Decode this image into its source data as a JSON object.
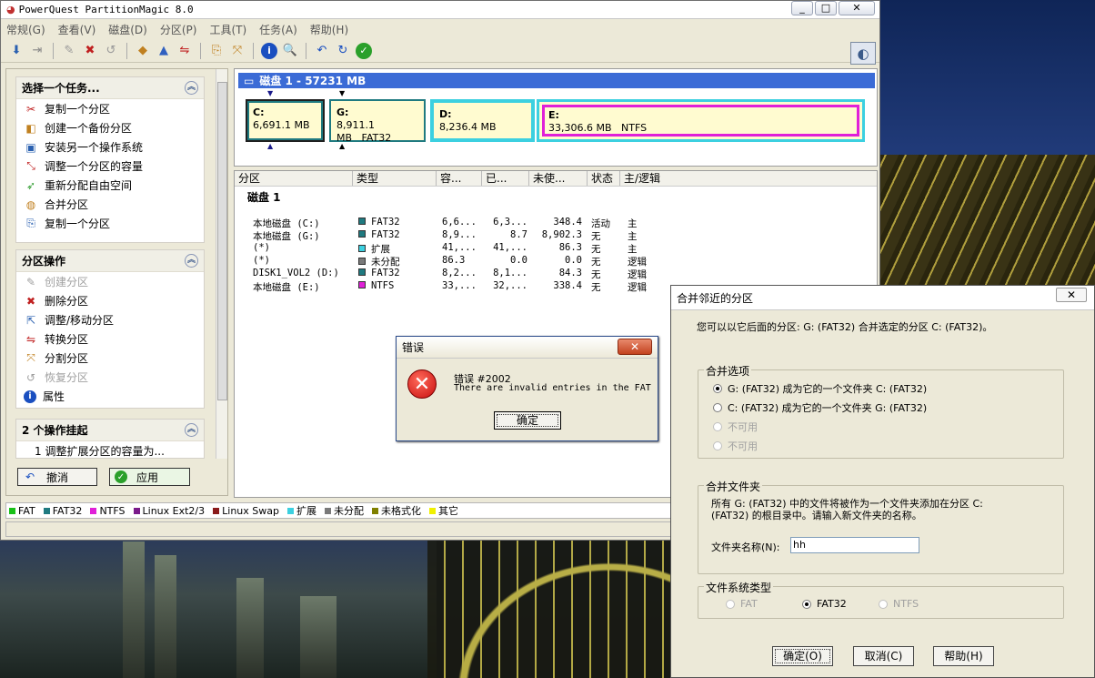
{
  "main_window": {
    "title": "PowerQuest PartitionMagic 8.0",
    "menus": [
      "常规(G)",
      "查看(V)",
      "磁盘(D)",
      "分区(P)",
      "工具(T)",
      "任务(A)",
      "帮助(H)"
    ],
    "window_controls": {
      "minimize": "_",
      "maximize": "□",
      "close": "✕"
    }
  },
  "sidebar": {
    "tasks": {
      "title": "选择一个任务...",
      "items": [
        "复制一个分区",
        "创建一个备份分区",
        "安装另一个操作系统",
        "调整一个分区的容量",
        "重新分配自由空间",
        "合并分区",
        "复制一个分区"
      ]
    },
    "partition_ops": {
      "title": "分区操作",
      "items": [
        "创建分区",
        "删除分区",
        "调整/移动分区",
        "转换分区",
        "分割分区",
        "恢复分区",
        "属性"
      ]
    },
    "pending": {
      "title": "2 个操作挂起",
      "item": "1   调整扩展分区的容量为..."
    },
    "undo_label": "撤消",
    "apply_label": "应用"
  },
  "disk_map": {
    "header": "磁盘 1 - 57231 MB",
    "partitions": [
      {
        "letter": "C:",
        "size": "6,691.1 MB",
        "fs": ""
      },
      {
        "letter": "G:",
        "size": "8,911.1 MB",
        "fs": "FAT32"
      },
      {
        "letter": "D:",
        "size": "8,236.4 MB",
        "fs": ""
      },
      {
        "letter": "E:",
        "size": "33,306.6 MB",
        "fs": "NTFS"
      }
    ]
  },
  "partition_grid": {
    "columns": [
      "分区",
      "类型",
      "容...",
      "已...",
      "未使...",
      "状态",
      "主/逻辑"
    ],
    "disk_label": "磁盘 1",
    "rows": [
      {
        "name": "本地磁盘 (C:)",
        "type": "FAT32",
        "color": "#1f7a80",
        "cap": "6,6...",
        "used": "6,3...",
        "free": "348.4",
        "status": "活动",
        "kind": "主"
      },
      {
        "name": "本地磁盘 (G:)",
        "type": "FAT32",
        "color": "#1f7a80",
        "cap": "8,9...",
        "used": "8.7",
        "free": "8,902.3",
        "status": "无",
        "kind": "主"
      },
      {
        "name": "(*)",
        "type": "扩展",
        "color": "#3cd0e0",
        "cap": "41,...",
        "used": "41,...",
        "free": "86.3",
        "status": "无",
        "kind": "主"
      },
      {
        "name": "(*)",
        "type": "未分配",
        "color": "#7a7a7a",
        "cap": "86.3",
        "used": "0.0",
        "free": "0.0",
        "status": "无",
        "kind": "逻辑"
      },
      {
        "name": "DISK1_VOL2 (D:)",
        "type": "FAT32",
        "color": "#1f7a80",
        "cap": "8,2...",
        "used": "8,1...",
        "free": "84.3",
        "status": "无",
        "kind": "逻辑"
      },
      {
        "name": "本地磁盘 (E:)",
        "type": "NTFS",
        "color": "#e020d8",
        "cap": "33,...",
        "used": "32,...",
        "free": "338.4",
        "status": "无",
        "kind": "逻辑"
      }
    ]
  },
  "legend": [
    {
      "label": "FAT",
      "color": "#18c018"
    },
    {
      "label": "FAT32",
      "color": "#1f7a80"
    },
    {
      "label": "NTFS",
      "color": "#e020d8"
    },
    {
      "label": "Linux Ext2/3",
      "color": "#7a1a8a"
    },
    {
      "label": "Linux Swap",
      "color": "#8a1a1a"
    },
    {
      "label": "扩展",
      "color": "#3cd0e0"
    },
    {
      "label": "未分配",
      "color": "#7a7a7a"
    },
    {
      "label": "未格式化",
      "color": "#808000"
    },
    {
      "label": "其它",
      "color": "#f0f000"
    }
  ],
  "error_dialog": {
    "title": "错误",
    "line1": "错误 #2002",
    "line2": "There are invalid entries in the FAT",
    "ok_label": "确定",
    "close": "✕"
  },
  "merge_dialog": {
    "title": "合并邻近的分区",
    "close": "✕",
    "intro": "您可以以它后面的分区: G:  (FAT32) 合并选定的分区 C:  (FAT32)。",
    "options_title": "合并选项",
    "options": [
      {
        "label": "G:  (FAT32)  成为它的一个文件夹  C:  (FAT32)",
        "checked": true,
        "disabled": false
      },
      {
        "label": "C:  (FAT32)  成为它的一个文件夹  G:  (FAT32)",
        "checked": false,
        "disabled": false
      },
      {
        "label": "不可用",
        "checked": false,
        "disabled": true
      },
      {
        "label": "不可用",
        "checked": false,
        "disabled": true
      }
    ],
    "folder_title": "合并文件夹",
    "folder_desc1": "所有 G:  (FAT32) 中的文件将被作为一个文件夹添加在分区 C:",
    "folder_desc2": "(FAT32) 的根目录中。请输入新文件夹的名称。",
    "folder_name_label": "文件夹名称(N):",
    "folder_name_value": "hh",
    "fs_title": "文件系统类型",
    "fs_options": [
      {
        "label": "FAT",
        "checked": false,
        "disabled": true
      },
      {
        "label": "FAT32",
        "checked": true,
        "disabled": false
      },
      {
        "label": "NTFS",
        "checked": false,
        "disabled": true
      }
    ],
    "ok_label": "确定(O)",
    "cancel_label": "取消(C)",
    "help_label": "帮助(H)"
  }
}
